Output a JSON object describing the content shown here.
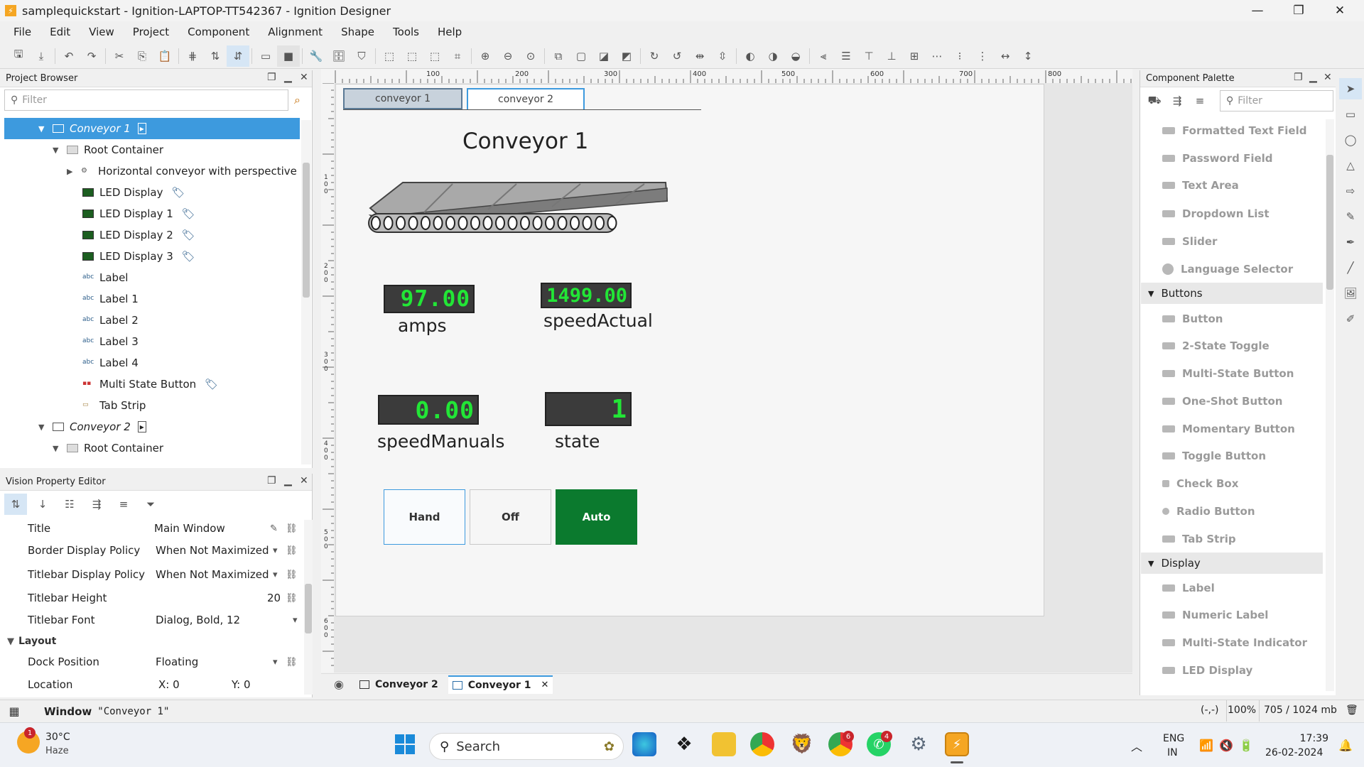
{
  "window": {
    "title": "samplequickstart - Ignition-LAPTOP-TT542367 - Ignition Designer"
  },
  "menu": [
    "File",
    "Edit",
    "View",
    "Project",
    "Component",
    "Alignment",
    "Shape",
    "Tools",
    "Help"
  ],
  "project_browser": {
    "title": "Project Browser",
    "filter_placeholder": "Filter",
    "items": [
      {
        "label": "Conveyor 1"
      },
      {
        "label": "Root Container"
      },
      {
        "label": "Horizontal conveyor with perspective"
      },
      {
        "label": "LED Display"
      },
      {
        "label": "LED Display 1"
      },
      {
        "label": "LED Display 2"
      },
      {
        "label": "LED Display 3"
      },
      {
        "label": "Label"
      },
      {
        "label": "Label 1"
      },
      {
        "label": "Label 2"
      },
      {
        "label": "Label 3"
      },
      {
        "label": "Label 4"
      },
      {
        "label": "Multi State Button"
      },
      {
        "label": "Tab Strip"
      },
      {
        "label": "Conveyor 2"
      },
      {
        "label": "Root Container"
      }
    ]
  },
  "property_editor": {
    "title": "Vision Property Editor",
    "rows": [
      {
        "name": "Title",
        "value": "Main Window"
      },
      {
        "name": "Border Display Policy",
        "value": "When Not Maximized"
      },
      {
        "name": "Titlebar Display Policy",
        "value": "When Not Maximized"
      },
      {
        "name": "Titlebar Height",
        "value": "20"
      },
      {
        "name": "Titlebar Font",
        "value": "Dialog, Bold, 12"
      },
      {
        "name": "Layout",
        "value": ""
      },
      {
        "name": "Dock Position",
        "value": "Floating"
      },
      {
        "name": "Location",
        "value": "X: 0",
        "value2": "Y: 0"
      }
    ]
  },
  "canvas": {
    "ruler_top": [
      "100",
      "200",
      "300",
      "400",
      "500",
      "600",
      "700",
      "800"
    ],
    "ruler_left": [
      "100",
      "200",
      "300",
      "400",
      "500",
      "600"
    ],
    "tabs": [
      "conveyor 1",
      "conveyor 2"
    ],
    "heading": "Conveyor 1",
    "leds": [
      {
        "value": "97.00",
        "label": "amps"
      },
      {
        "value": "1499.00",
        "label": "speedActual"
      },
      {
        "value": "0.00",
        "label": "speedManuals"
      },
      {
        "value": "1",
        "label": "state"
      }
    ],
    "buttons": [
      {
        "label": "Hand"
      },
      {
        "label": "Off"
      },
      {
        "label": "Auto"
      }
    ],
    "colors": {
      "auto_active": "#0b7a2e",
      "led_text": "#22e636"
    },
    "doc_tabs": [
      "Conveyor 2",
      "Conveyor 1"
    ]
  },
  "palette": {
    "title": "Component Palette",
    "filter_placeholder": "Filter",
    "items_top": [
      "Formatted Text Field",
      "Password Field",
      "Text Area",
      "Dropdown List",
      "Slider",
      "Language Selector"
    ],
    "section_buttons": "Buttons",
    "buttons": [
      "Button",
      "2-State Toggle",
      "Multi-State Button",
      "One-Shot Button",
      "Momentary Button",
      "Toggle Button",
      "Check Box",
      "Radio Button",
      "Tab Strip"
    ],
    "section_display": "Display",
    "display": [
      "Label",
      "Numeric Label",
      "Multi-State Indicator",
      "LED Display"
    ]
  },
  "status": {
    "window_label": "Window",
    "window_name": "\"Conveyor 1\"",
    "coords": "(-,-)",
    "zoom": "100%",
    "memory": "705 / 1024 mb"
  },
  "taskbar": {
    "weather_temp": "30°C",
    "weather_desc": "Haze",
    "weather_badge": "1",
    "search_label": "Search",
    "lang1": "ENG",
    "lang2": "IN",
    "time": "17:39",
    "date": "26-02-2024",
    "chrome_badge": "6",
    "whatsapp_badge": "4"
  }
}
